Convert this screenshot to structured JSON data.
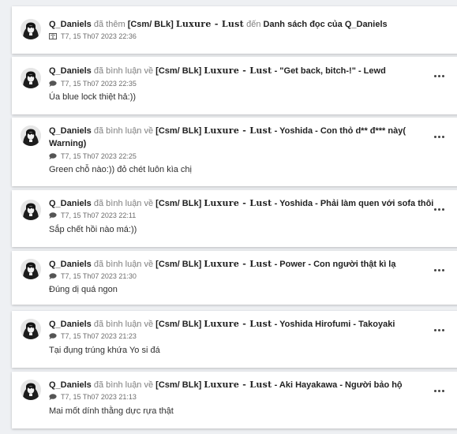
{
  "activity": [
    {
      "type": "list",
      "user": "Q_Daniels",
      "verb_before": "đã thêm",
      "tag": "[Csm/ BLk]",
      "series": "Luxure - Lust",
      "verb_after": "đến",
      "destination": "Danh sách đọc của Q_Daniels",
      "timestamp": "T7, 15 Th07 2023 22:36",
      "meta_icon": "book-icon"
    },
    {
      "type": "comment",
      "user": "Q_Daniels",
      "verb": "đã bình luận về",
      "tag": "[Csm/ BLk]",
      "series": "Luxure - Lust",
      "chapter": "- \"Get back, bitch-!\" - Lewd",
      "timestamp": "T7, 15 Th07 2023 22:35",
      "comment": "Úa blue lock thiệt hả:))",
      "meta_icon": "comment-icon"
    },
    {
      "type": "comment",
      "user": "Q_Daniels",
      "verb": "đã bình luận về",
      "tag": "[Csm/ BLk]",
      "series": "Luxure - Lust",
      "chapter": "- Yoshida - Con thỏ d** đ*** này(",
      "chapter_wrap": "Warning)",
      "timestamp": "T7, 15 Th07 2023 22:25",
      "comment": "Green chỗ nào:)) đỏ chét luôn kìa chị",
      "meta_icon": "comment-icon"
    },
    {
      "type": "comment",
      "user": "Q_Daniels",
      "verb": "đã bình luận về",
      "tag": "[Csm/ BLk]",
      "series": "Luxure - Lust",
      "chapter": "- Yoshida - Phải làm quen với sofa thôi",
      "timestamp": "T7, 15 Th07 2023 22:11",
      "comment": "Sắp chết hồi nào má:))",
      "meta_icon": "comment-icon"
    },
    {
      "type": "comment",
      "user": "Q_Daniels",
      "verb": "đã bình luận về",
      "tag": "[Csm/ BLk]",
      "series": "Luxure - Lust",
      "chapter": "- Power - Con người thật kì lạ",
      "timestamp": "T7, 15 Th07 2023 21:30",
      "comment": "Đúng dị quá ngon",
      "meta_icon": "comment-icon"
    },
    {
      "type": "comment",
      "user": "Q_Daniels",
      "verb": "đã bình luận về",
      "tag": "[Csm/ BLk]",
      "series": "Luxure - Lust",
      "chapter": "- Yoshida Hirofumi - Takoyaki",
      "timestamp": "T7, 15 Th07 2023 21:23",
      "comment": "Tại đụng trúng khứa Yo si đá",
      "meta_icon": "comment-icon"
    },
    {
      "type": "comment",
      "user": "Q_Daniels",
      "verb": "đã bình luận về",
      "tag": "[Csm/ BLk]",
      "series": "Luxure - Lust",
      "chapter": "- Aki Hayakawa - Người bảo hộ",
      "timestamp": "T7, 15 Th07 2023 21:13",
      "comment": "Mai mốt dính thằng dực rựa thật",
      "meta_icon": "comment-icon"
    }
  ],
  "menu_icon": "more-options-icon",
  "avatar_icon": "user-avatar"
}
